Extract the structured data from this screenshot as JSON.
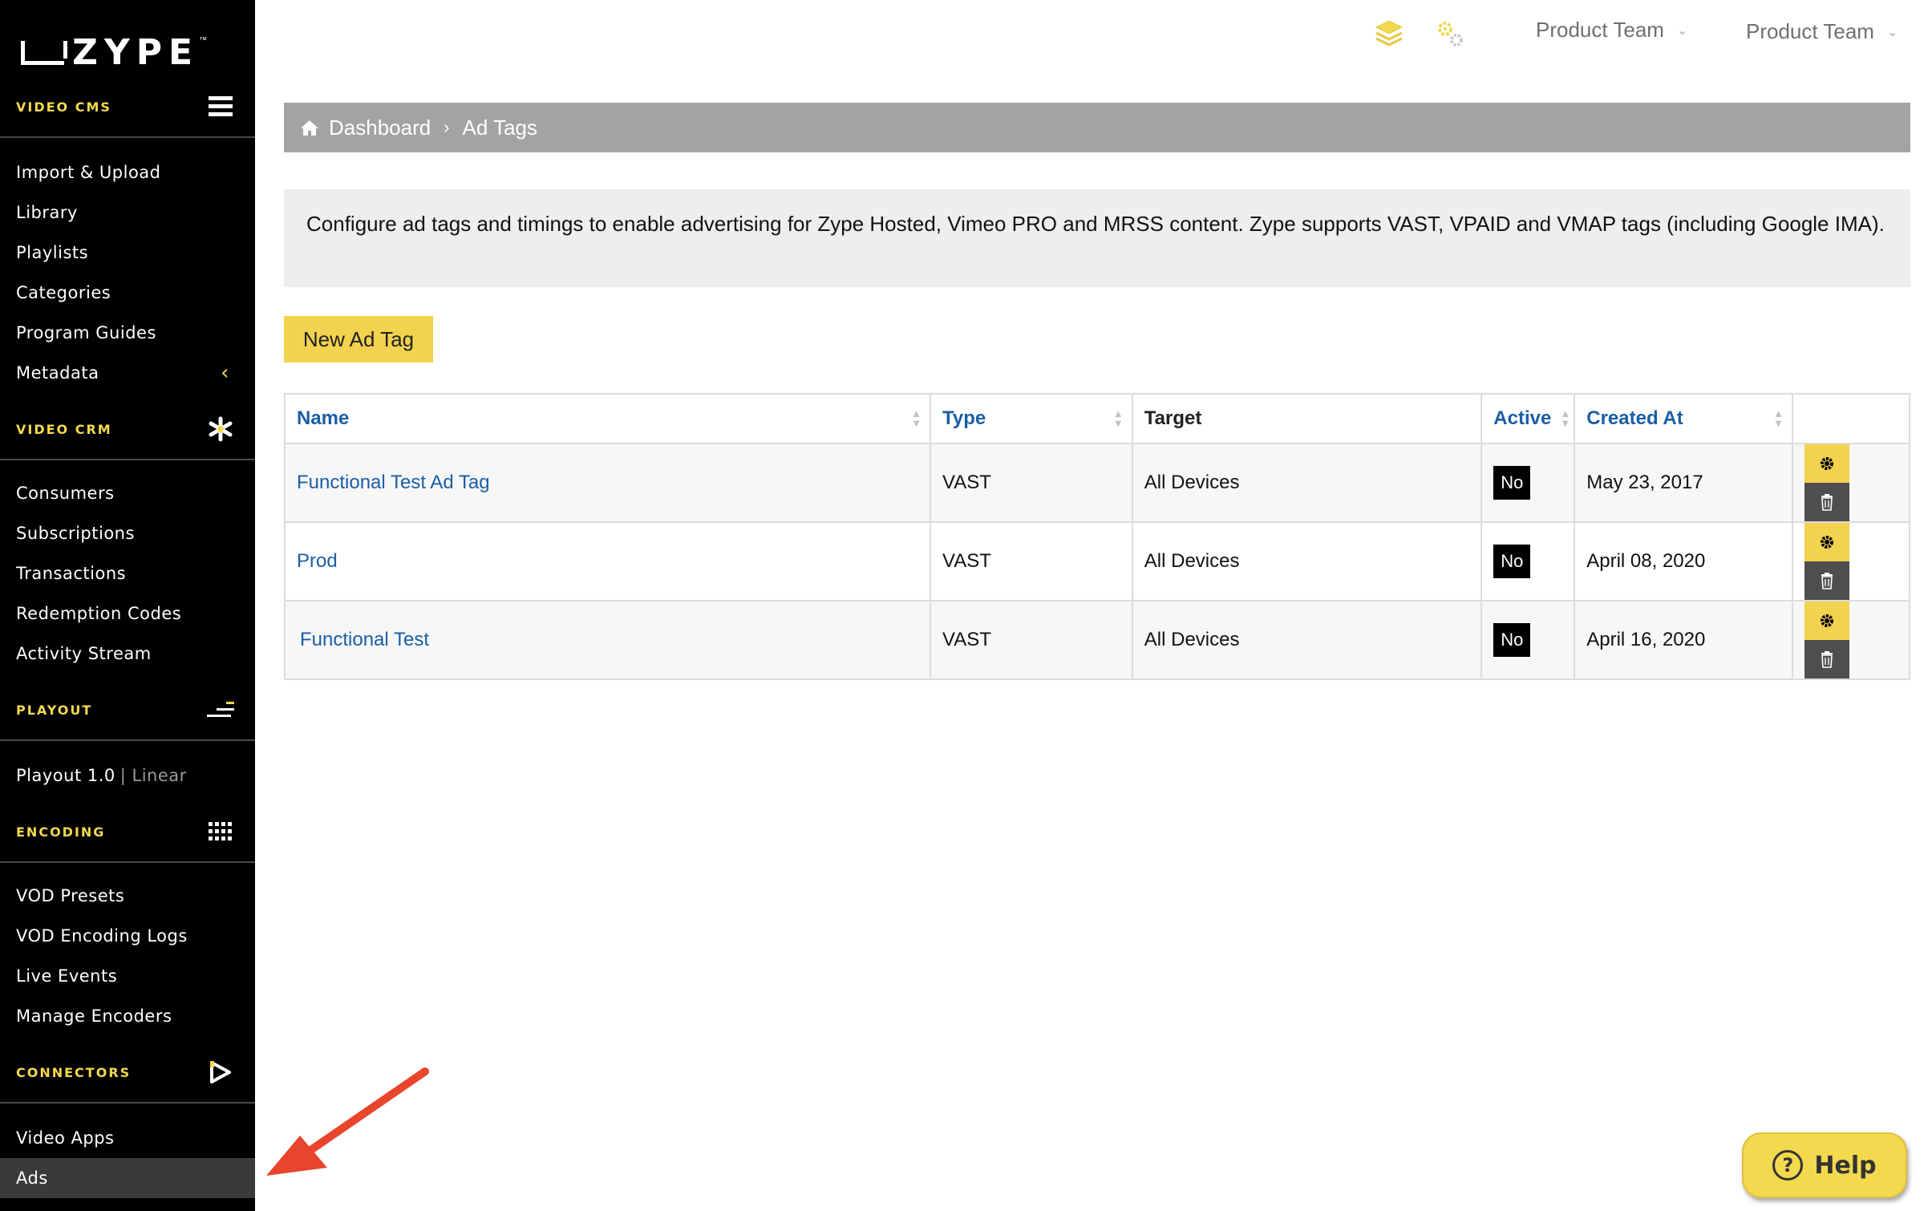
{
  "brand": {
    "name": "ZYPE",
    "tm": "™"
  },
  "sidebar": {
    "sections": [
      {
        "title": "VIDEO CMS",
        "icon": "hamburger-icon",
        "items": [
          "Import & Upload",
          "Library",
          "Playlists",
          "Categories",
          "Program Guides",
          "Metadata"
        ]
      },
      {
        "title": "VIDEO CRM",
        "icon": "asterisk-icon",
        "items": [
          "Consumers",
          "Subscriptions",
          "Transactions",
          "Redemption Codes",
          "Activity Stream"
        ]
      },
      {
        "title": "PLAYOUT",
        "icon": "playout-lines-icon",
        "items": [
          "Playout 1.0"
        ],
        "playout_sub": "| Linear"
      },
      {
        "title": "ENCODING",
        "icon": "grid-dots-icon",
        "items": [
          "VOD Presets",
          "VOD Encoding Logs",
          "Live Events",
          "Manage Encoders"
        ]
      },
      {
        "title": "CONNECTORS",
        "icon": "play-connector-icon",
        "items": [
          "Video Apps",
          "Ads"
        ]
      }
    ],
    "active_item": "Ads"
  },
  "topbar": {
    "team_1": "Product Team",
    "team_2": "Product Team",
    "icons": [
      "layers-icon",
      "gears-icon"
    ]
  },
  "breadcrumb": {
    "home": "Dashboard",
    "current": "Ad Tags"
  },
  "info_text": "Configure ad tags and timings to enable advertising for Zype Hosted, Vimeo PRO and MRSS content. Zype supports VAST, VPAID and VMAP tags (including Google IMA).",
  "new_button": "New Ad Tag",
  "table": {
    "headers": {
      "name": "Name",
      "type": "Type",
      "target": "Target",
      "active": "Active",
      "created": "Created At"
    },
    "rows": [
      {
        "name": "Functional Test Ad Tag",
        "type": "VAST",
        "target": "All Devices",
        "active": "No",
        "created": "May 23, 2017"
      },
      {
        "name": "Prod",
        "type": "VAST",
        "target": "All Devices",
        "active": "No",
        "created": "April 08, 2020"
      },
      {
        "name": "Functional Test",
        "type": "VAST",
        "target": "All Devices",
        "active": "No",
        "created": "April 16, 2020"
      }
    ]
  },
  "help": {
    "label": "Help",
    "glyph": "?"
  },
  "colors": {
    "accent": "#f3d94e",
    "link": "#1a5ea6",
    "arrow": "#e8452c",
    "sidebar": "#000000"
  }
}
